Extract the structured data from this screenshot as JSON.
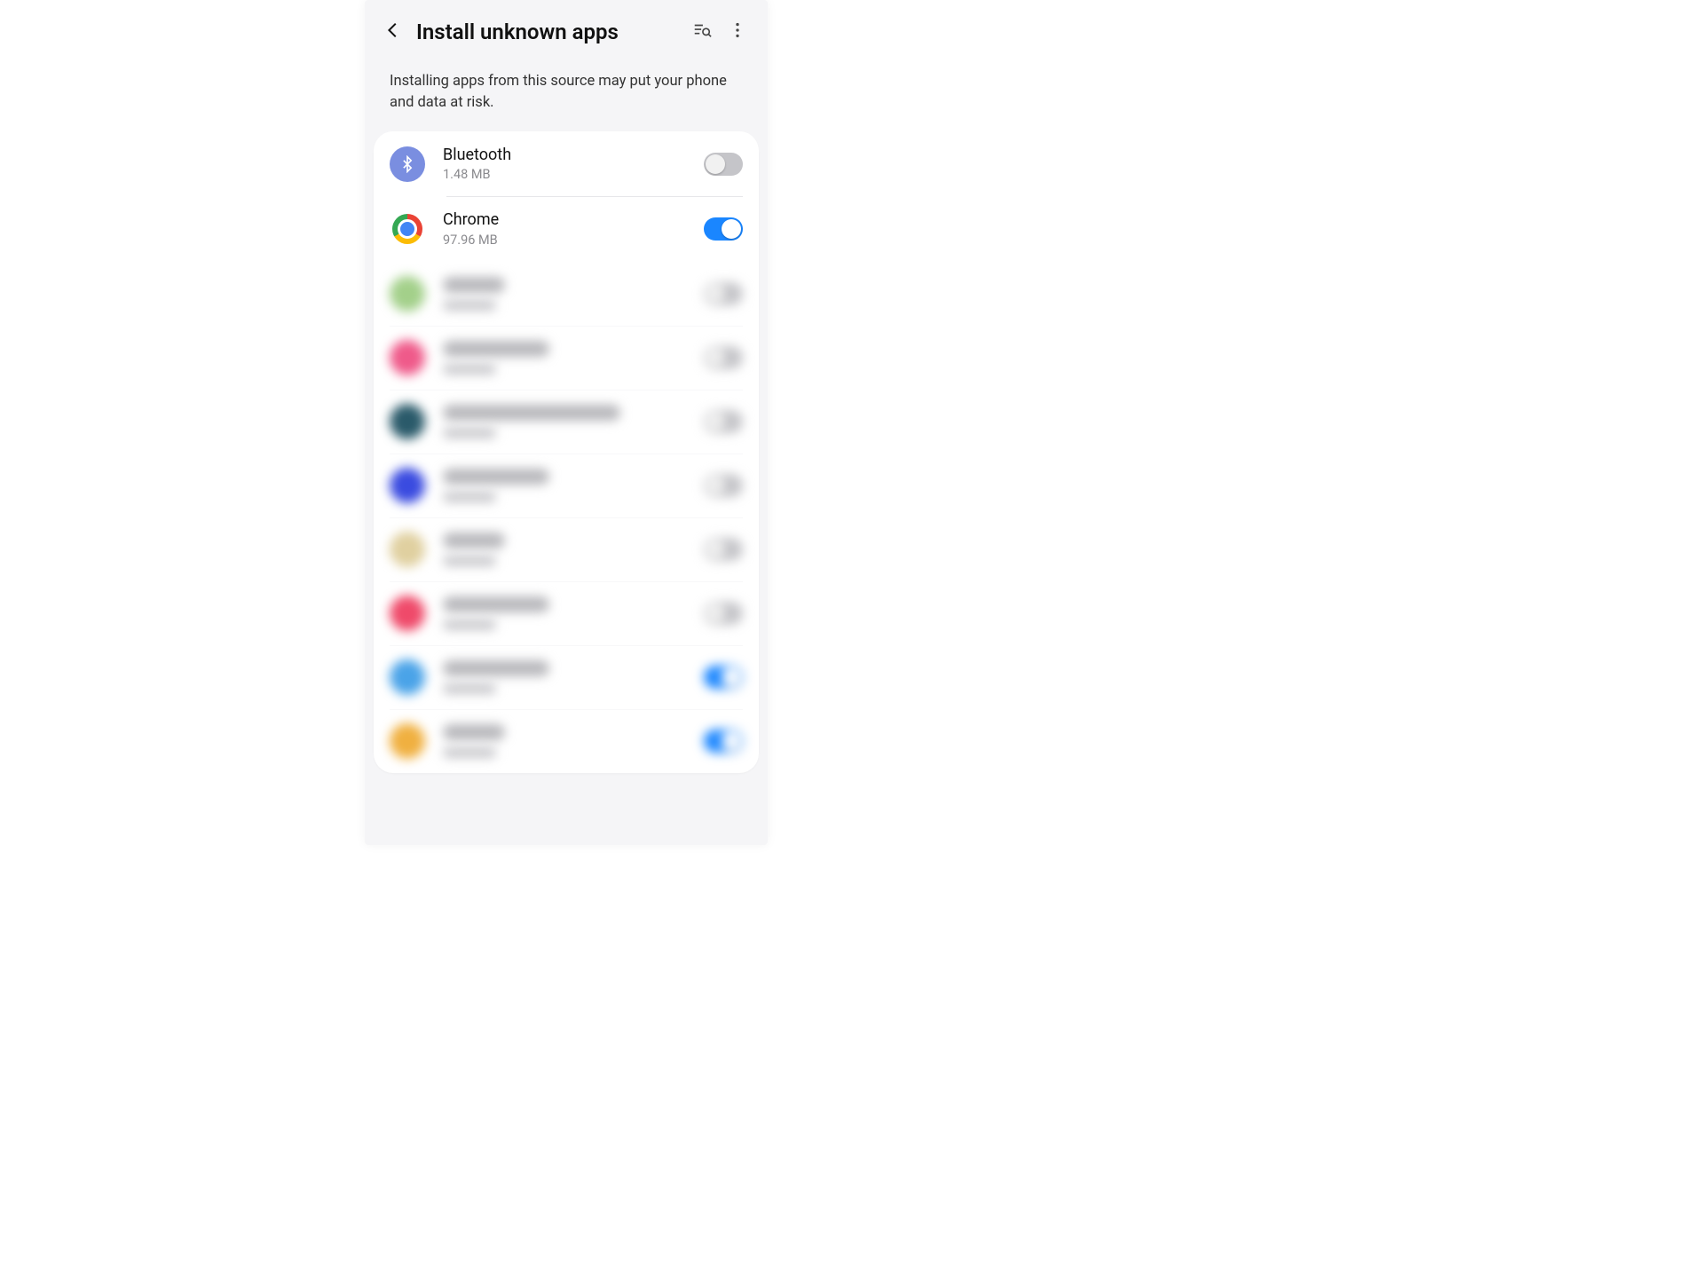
{
  "header": {
    "title": "Install unknown apps"
  },
  "description": "Installing apps from this source may put your phone and data at risk.",
  "apps": {
    "bluetooth": {
      "name": "Bluetooth",
      "size": "1.48 MB",
      "enabled": false
    },
    "chrome": {
      "name": "Chrome",
      "size": "97.96 MB",
      "enabled": true
    }
  },
  "blurred_rows": [
    {
      "icon_color": "#a3d08a",
      "title_w": "s",
      "toggle": "off"
    },
    {
      "icon_color": "#ef5a8a",
      "title_w": "m",
      "toggle": "off"
    },
    {
      "icon_color": "#2a5a6a",
      "title_w": "l",
      "toggle": "off"
    },
    {
      "icon_color": "#3a4be0",
      "title_w": "m",
      "toggle": "off"
    },
    {
      "icon_color": "#e0d0a0",
      "title_w": "s",
      "toggle": "off"
    },
    {
      "icon_color": "#ef4a6a",
      "title_w": "m",
      "toggle": "off"
    },
    {
      "icon_color": "#4aa3e8",
      "title_w": "m",
      "toggle": "on"
    },
    {
      "icon_color": "#f0b040",
      "title_w": "s",
      "toggle": "on"
    }
  ]
}
